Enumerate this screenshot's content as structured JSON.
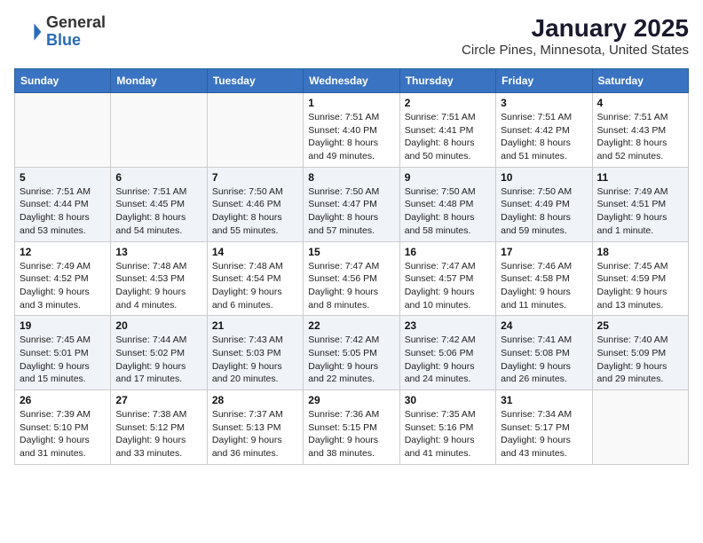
{
  "header": {
    "logo_general": "General",
    "logo_blue": "Blue",
    "month_title": "January 2025",
    "location": "Circle Pines, Minnesota, United States"
  },
  "calendar": {
    "days_of_week": [
      "Sunday",
      "Monday",
      "Tuesday",
      "Wednesday",
      "Thursday",
      "Friday",
      "Saturday"
    ],
    "weeks": [
      [
        {
          "day": "",
          "sunrise": "",
          "sunset": "",
          "daylight": ""
        },
        {
          "day": "",
          "sunrise": "",
          "sunset": "",
          "daylight": ""
        },
        {
          "day": "",
          "sunrise": "",
          "sunset": "",
          "daylight": ""
        },
        {
          "day": "1",
          "sunrise": "Sunrise: 7:51 AM",
          "sunset": "Sunset: 4:40 PM",
          "daylight": "Daylight: 8 hours and 49 minutes."
        },
        {
          "day": "2",
          "sunrise": "Sunrise: 7:51 AM",
          "sunset": "Sunset: 4:41 PM",
          "daylight": "Daylight: 8 hours and 50 minutes."
        },
        {
          "day": "3",
          "sunrise": "Sunrise: 7:51 AM",
          "sunset": "Sunset: 4:42 PM",
          "daylight": "Daylight: 8 hours and 51 minutes."
        },
        {
          "day": "4",
          "sunrise": "Sunrise: 7:51 AM",
          "sunset": "Sunset: 4:43 PM",
          "daylight": "Daylight: 8 hours and 52 minutes."
        }
      ],
      [
        {
          "day": "5",
          "sunrise": "Sunrise: 7:51 AM",
          "sunset": "Sunset: 4:44 PM",
          "daylight": "Daylight: 8 hours and 53 minutes."
        },
        {
          "day": "6",
          "sunrise": "Sunrise: 7:51 AM",
          "sunset": "Sunset: 4:45 PM",
          "daylight": "Daylight: 8 hours and 54 minutes."
        },
        {
          "day": "7",
          "sunrise": "Sunrise: 7:50 AM",
          "sunset": "Sunset: 4:46 PM",
          "daylight": "Daylight: 8 hours and 55 minutes."
        },
        {
          "day": "8",
          "sunrise": "Sunrise: 7:50 AM",
          "sunset": "Sunset: 4:47 PM",
          "daylight": "Daylight: 8 hours and 57 minutes."
        },
        {
          "day": "9",
          "sunrise": "Sunrise: 7:50 AM",
          "sunset": "Sunset: 4:48 PM",
          "daylight": "Daylight: 8 hours and 58 minutes."
        },
        {
          "day": "10",
          "sunrise": "Sunrise: 7:50 AM",
          "sunset": "Sunset: 4:49 PM",
          "daylight": "Daylight: 8 hours and 59 minutes."
        },
        {
          "day": "11",
          "sunrise": "Sunrise: 7:49 AM",
          "sunset": "Sunset: 4:51 PM",
          "daylight": "Daylight: 9 hours and 1 minute."
        }
      ],
      [
        {
          "day": "12",
          "sunrise": "Sunrise: 7:49 AM",
          "sunset": "Sunset: 4:52 PM",
          "daylight": "Daylight: 9 hours and 3 minutes."
        },
        {
          "day": "13",
          "sunrise": "Sunrise: 7:48 AM",
          "sunset": "Sunset: 4:53 PM",
          "daylight": "Daylight: 9 hours and 4 minutes."
        },
        {
          "day": "14",
          "sunrise": "Sunrise: 7:48 AM",
          "sunset": "Sunset: 4:54 PM",
          "daylight": "Daylight: 9 hours and 6 minutes."
        },
        {
          "day": "15",
          "sunrise": "Sunrise: 7:47 AM",
          "sunset": "Sunset: 4:56 PM",
          "daylight": "Daylight: 9 hours and 8 minutes."
        },
        {
          "day": "16",
          "sunrise": "Sunrise: 7:47 AM",
          "sunset": "Sunset: 4:57 PM",
          "daylight": "Daylight: 9 hours and 10 minutes."
        },
        {
          "day": "17",
          "sunrise": "Sunrise: 7:46 AM",
          "sunset": "Sunset: 4:58 PM",
          "daylight": "Daylight: 9 hours and 11 minutes."
        },
        {
          "day": "18",
          "sunrise": "Sunrise: 7:45 AM",
          "sunset": "Sunset: 4:59 PM",
          "daylight": "Daylight: 9 hours and 13 minutes."
        }
      ],
      [
        {
          "day": "19",
          "sunrise": "Sunrise: 7:45 AM",
          "sunset": "Sunset: 5:01 PM",
          "daylight": "Daylight: 9 hours and 15 minutes."
        },
        {
          "day": "20",
          "sunrise": "Sunrise: 7:44 AM",
          "sunset": "Sunset: 5:02 PM",
          "daylight": "Daylight: 9 hours and 17 minutes."
        },
        {
          "day": "21",
          "sunrise": "Sunrise: 7:43 AM",
          "sunset": "Sunset: 5:03 PM",
          "daylight": "Daylight: 9 hours and 20 minutes."
        },
        {
          "day": "22",
          "sunrise": "Sunrise: 7:42 AM",
          "sunset": "Sunset: 5:05 PM",
          "daylight": "Daylight: 9 hours and 22 minutes."
        },
        {
          "day": "23",
          "sunrise": "Sunrise: 7:42 AM",
          "sunset": "Sunset: 5:06 PM",
          "daylight": "Daylight: 9 hours and 24 minutes."
        },
        {
          "day": "24",
          "sunrise": "Sunrise: 7:41 AM",
          "sunset": "Sunset: 5:08 PM",
          "daylight": "Daylight: 9 hours and 26 minutes."
        },
        {
          "day": "25",
          "sunrise": "Sunrise: 7:40 AM",
          "sunset": "Sunset: 5:09 PM",
          "daylight": "Daylight: 9 hours and 29 minutes."
        }
      ],
      [
        {
          "day": "26",
          "sunrise": "Sunrise: 7:39 AM",
          "sunset": "Sunset: 5:10 PM",
          "daylight": "Daylight: 9 hours and 31 minutes."
        },
        {
          "day": "27",
          "sunrise": "Sunrise: 7:38 AM",
          "sunset": "Sunset: 5:12 PM",
          "daylight": "Daylight: 9 hours and 33 minutes."
        },
        {
          "day": "28",
          "sunrise": "Sunrise: 7:37 AM",
          "sunset": "Sunset: 5:13 PM",
          "daylight": "Daylight: 9 hours and 36 minutes."
        },
        {
          "day": "29",
          "sunrise": "Sunrise: 7:36 AM",
          "sunset": "Sunset: 5:15 PM",
          "daylight": "Daylight: 9 hours and 38 minutes."
        },
        {
          "day": "30",
          "sunrise": "Sunrise: 7:35 AM",
          "sunset": "Sunset: 5:16 PM",
          "daylight": "Daylight: 9 hours and 41 minutes."
        },
        {
          "day": "31",
          "sunrise": "Sunrise: 7:34 AM",
          "sunset": "Sunset: 5:17 PM",
          "daylight": "Daylight: 9 hours and 43 minutes."
        },
        {
          "day": "",
          "sunrise": "",
          "sunset": "",
          "daylight": ""
        }
      ]
    ]
  }
}
